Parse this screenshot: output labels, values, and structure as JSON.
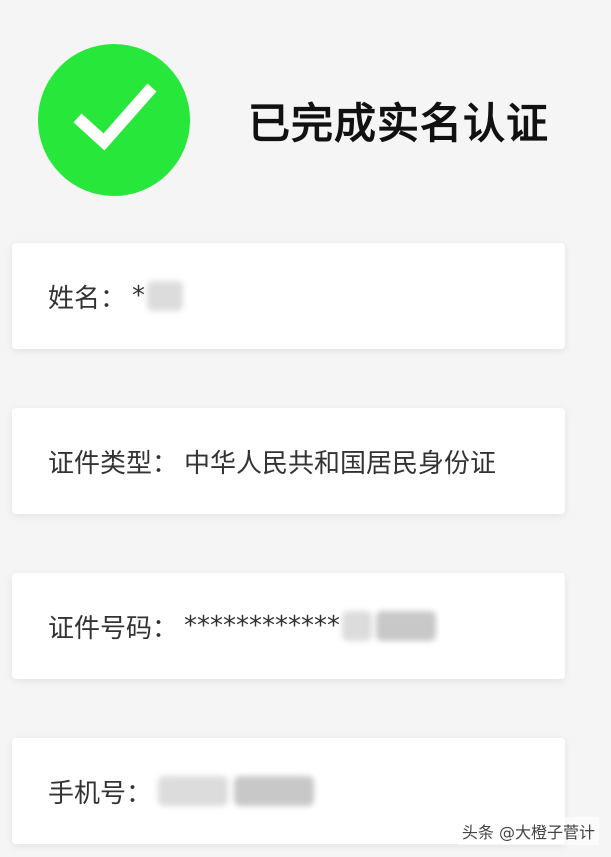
{
  "header": {
    "title": "已完成实名认证",
    "icon": "check-icon",
    "accent_color": "#27e83a"
  },
  "fields": {
    "name": {
      "label": "姓名：",
      "value": "*"
    },
    "id_type": {
      "label": "证件类型：",
      "value": "中华人民共和国居民身份证"
    },
    "id_number": {
      "label": "证件号码：",
      "value": "************"
    },
    "phone": {
      "label": "手机号：",
      "value": ""
    }
  },
  "watermark": "头条 @大橙子菅计"
}
